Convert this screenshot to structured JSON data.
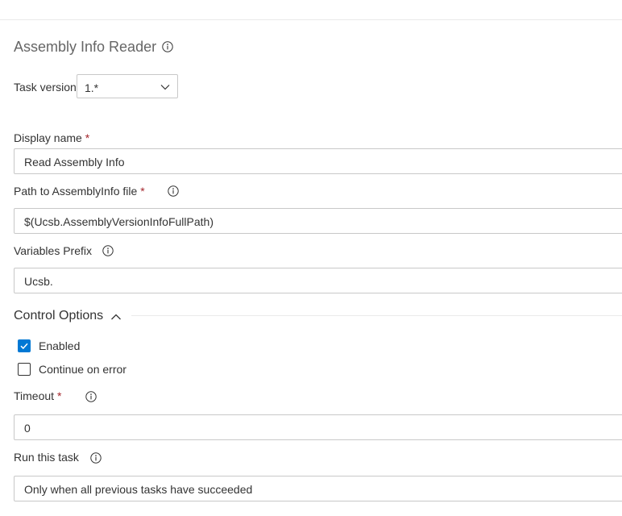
{
  "task": {
    "title": "Assembly Info Reader",
    "version_label": "Task version",
    "version_value": "1.*"
  },
  "fields": {
    "display_name": {
      "label": "Display name",
      "required_mark": "*",
      "value": "Read Assembly Info"
    },
    "path": {
      "label": "Path to AssemblyInfo file",
      "required_mark": "*",
      "value": "$(Ucsb.AssemblyVersionInfoFullPath)"
    },
    "prefix": {
      "label": "Variables Prefix",
      "value": "Ucsb."
    }
  },
  "control_options": {
    "title": "Control Options",
    "enabled": {
      "label": "Enabled",
      "checked": true
    },
    "continue_on_error": {
      "label": "Continue on error",
      "checked": false
    },
    "timeout": {
      "label": "Timeout",
      "required_mark": "*",
      "value": "0"
    },
    "run_condition": {
      "label": "Run this task",
      "value": "Only when all previous tasks have succeeded"
    }
  },
  "colors": {
    "accent": "#0078d4",
    "required": "#a4262c",
    "border": "#c8c8c8"
  }
}
